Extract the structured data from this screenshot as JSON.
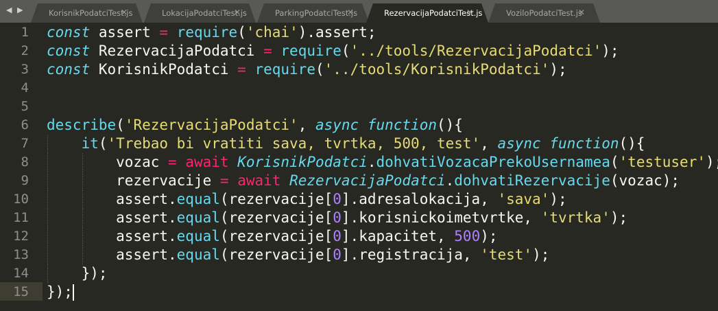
{
  "tabs": [
    {
      "label": "KorisnikPodatciTest.js",
      "active": false
    },
    {
      "label": "LokacijaPodatciTest.js",
      "active": false
    },
    {
      "label": "ParkingPodatciTest.js",
      "active": false
    },
    {
      "label": "RezervacijaPodatciTest.js",
      "active": true
    },
    {
      "label": "VoziloPodatciTest.js",
      "active": false
    }
  ],
  "nav_arrows": "◀ ▶",
  "close_glyph": "✕",
  "current_line": 15,
  "lines": [
    [
      [
        "storage",
        "const"
      ],
      [
        "plain",
        " assert "
      ],
      [
        "op",
        "="
      ],
      [
        "plain",
        " "
      ],
      [
        "fn",
        "require"
      ],
      [
        "plain",
        "("
      ],
      [
        "str",
        "'chai'"
      ],
      [
        "plain",
        ").assert;"
      ]
    ],
    [
      [
        "storage",
        "const"
      ],
      [
        "plain",
        " RezervacijaPodatci "
      ],
      [
        "op",
        "="
      ],
      [
        "plain",
        " "
      ],
      [
        "fn",
        "require"
      ],
      [
        "plain",
        "("
      ],
      [
        "str",
        "'../tools/RezervacijaPodatci'"
      ],
      [
        "plain",
        ");"
      ]
    ],
    [
      [
        "storage",
        "const"
      ],
      [
        "plain",
        " KorisnikPodatci "
      ],
      [
        "op",
        "="
      ],
      [
        "plain",
        " "
      ],
      [
        "fn",
        "require"
      ],
      [
        "plain",
        "("
      ],
      [
        "str",
        "'../tools/KorisnikPodatci'"
      ],
      [
        "plain",
        ");"
      ]
    ],
    [],
    [],
    [
      [
        "fn",
        "describe"
      ],
      [
        "plain",
        "("
      ],
      [
        "str",
        "'RezervacijaPodatci'"
      ],
      [
        "plain",
        ", "
      ],
      [
        "storage",
        "async function"
      ],
      [
        "plain",
        "(){"
      ]
    ],
    [
      [
        "plain",
        "    "
      ],
      [
        "fn",
        "it"
      ],
      [
        "plain",
        "("
      ],
      [
        "str",
        "'Trebao bi vratiti sava, tvrtka, 500, test'"
      ],
      [
        "plain",
        ", "
      ],
      [
        "storage",
        "async function"
      ],
      [
        "plain",
        "(){"
      ]
    ],
    [
      [
        "plain",
        "        vozac "
      ],
      [
        "op",
        "="
      ],
      [
        "plain",
        " "
      ],
      [
        "kw",
        "await"
      ],
      [
        "plain",
        " "
      ],
      [
        "cls",
        "KorisnikPodatci"
      ],
      [
        "plain",
        "."
      ],
      [
        "fn",
        "dohvatiVozacaPrekoUsernamea"
      ],
      [
        "plain",
        "("
      ],
      [
        "str",
        "'testuser'"
      ],
      [
        "plain",
        ");"
      ]
    ],
    [
      [
        "plain",
        "        rezervacije "
      ],
      [
        "op",
        "="
      ],
      [
        "plain",
        " "
      ],
      [
        "kw",
        "await"
      ],
      [
        "plain",
        " "
      ],
      [
        "cls",
        "RezervacijaPodatci"
      ],
      [
        "plain",
        "."
      ],
      [
        "fn",
        "dohvatiRezervacije"
      ],
      [
        "plain",
        "(vozac);"
      ]
    ],
    [
      [
        "plain",
        "        assert."
      ],
      [
        "fn",
        "equal"
      ],
      [
        "plain",
        "(rezervacije["
      ],
      [
        "num",
        "0"
      ],
      [
        "plain",
        "].adresalokacija, "
      ],
      [
        "str",
        "'sava'"
      ],
      [
        "plain",
        ");"
      ]
    ],
    [
      [
        "plain",
        "        assert."
      ],
      [
        "fn",
        "equal"
      ],
      [
        "plain",
        "(rezervacije["
      ],
      [
        "num",
        "0"
      ],
      [
        "plain",
        "].korisnickoimetvrtke, "
      ],
      [
        "str",
        "'tvrtka'"
      ],
      [
        "plain",
        ");"
      ]
    ],
    [
      [
        "plain",
        "        assert."
      ],
      [
        "fn",
        "equal"
      ],
      [
        "plain",
        "(rezervacije["
      ],
      [
        "num",
        "0"
      ],
      [
        "plain",
        "].kapacitet, "
      ],
      [
        "num",
        "500"
      ],
      [
        "plain",
        ");"
      ]
    ],
    [
      [
        "plain",
        "        assert."
      ],
      [
        "fn",
        "equal"
      ],
      [
        "plain",
        "(rezervacije["
      ],
      [
        "num",
        "0"
      ],
      [
        "plain",
        "].registracija, "
      ],
      [
        "str",
        "'test'"
      ],
      [
        "plain",
        ");"
      ]
    ],
    [
      [
        "plain",
        "    });"
      ]
    ],
    [
      [
        "plain",
        "});"
      ]
    ]
  ],
  "line_numbers": [
    "1",
    "2",
    "3",
    "4",
    "5",
    "6",
    "7",
    "8",
    "9",
    "10",
    "11",
    "12",
    "13",
    "14",
    "15"
  ]
}
